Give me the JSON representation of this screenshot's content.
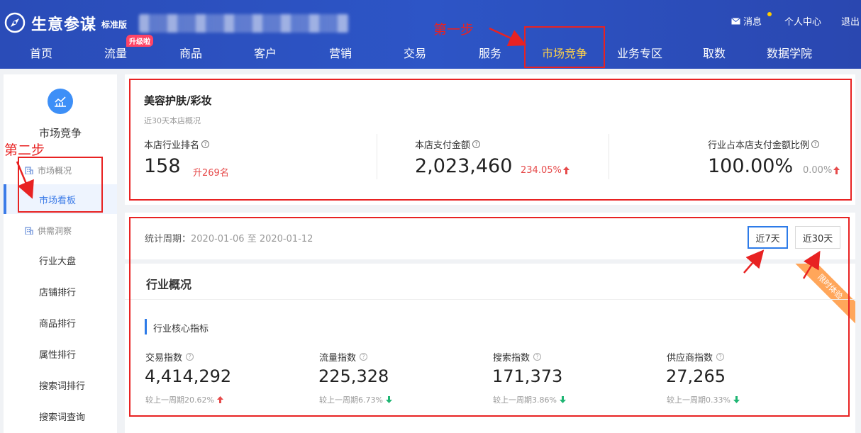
{
  "header": {
    "brand": "生意参谋",
    "edition": "标准版",
    "links": {
      "message": "消息",
      "user_center": "个人中心",
      "logout": "退出"
    },
    "nav": [
      {
        "label": "首页"
      },
      {
        "label": "流量",
        "badge": "升级啦"
      },
      {
        "label": "商品"
      },
      {
        "label": "客户"
      },
      {
        "label": "营销"
      },
      {
        "label": "交易"
      },
      {
        "label": "服务"
      },
      {
        "label": "市场竞争",
        "active": true
      },
      {
        "label": "业务专区"
      },
      {
        "label": "取数"
      },
      {
        "label": "数据学院"
      }
    ]
  },
  "sidebar": {
    "title": "市场竞争",
    "groups": [
      {
        "label": "市场概况",
        "items": [
          {
            "label": "市场看板",
            "active": true
          }
        ]
      },
      {
        "label": "供需洞察",
        "items": [
          {
            "label": "行业大盘"
          },
          {
            "label": "店铺排行"
          },
          {
            "label": "商品排行"
          },
          {
            "label": "属性排行"
          },
          {
            "label": "搜索词排行"
          },
          {
            "label": "搜索词查询"
          }
        ]
      }
    ]
  },
  "overview": {
    "category": "美容护肤/彩妆",
    "subtitle": "近30天本店概况",
    "kpis": [
      {
        "label": "本店行业排名",
        "value": "158",
        "change": "升269名"
      },
      {
        "label": "本店支付金额",
        "value": "2,023,460",
        "change": "234.05%"
      },
      {
        "label": "行业占本店支付金额比例",
        "value": "100.00%",
        "change": "0.00%"
      }
    ]
  },
  "period": {
    "label": "统计周期：",
    "value": "2020-01-06 至 2020-01-12",
    "buttons": [
      {
        "label": "近7天",
        "active": true
      },
      {
        "label": "近30天"
      }
    ]
  },
  "industry": {
    "title": "行业概况",
    "core_title": "行业核心指标",
    "ribbon": "限时体验",
    "metrics": [
      {
        "label": "交易指数",
        "value": "4,414,292",
        "change": "较上一周期20.62%",
        "direction": "up"
      },
      {
        "label": "流量指数",
        "value": "225,328",
        "change": "较上一周期6.73%",
        "direction": "down"
      },
      {
        "label": "搜索指数",
        "value": "171,373",
        "change": "较上一周期3.86%",
        "direction": "down"
      },
      {
        "label": "供应商指数",
        "value": "27,265",
        "change": "较上一周期0.33%",
        "direction": "down"
      }
    ]
  },
  "annotations": {
    "step1": "第一步",
    "step2": "第二步"
  },
  "colors": {
    "header_bg": "#2d55c6",
    "nav_active": "#ffd24a",
    "accent": "#2d7be8",
    "up_red": "#e64a4a",
    "down_green": "#1fb573",
    "annotation_red": "#e82222"
  }
}
